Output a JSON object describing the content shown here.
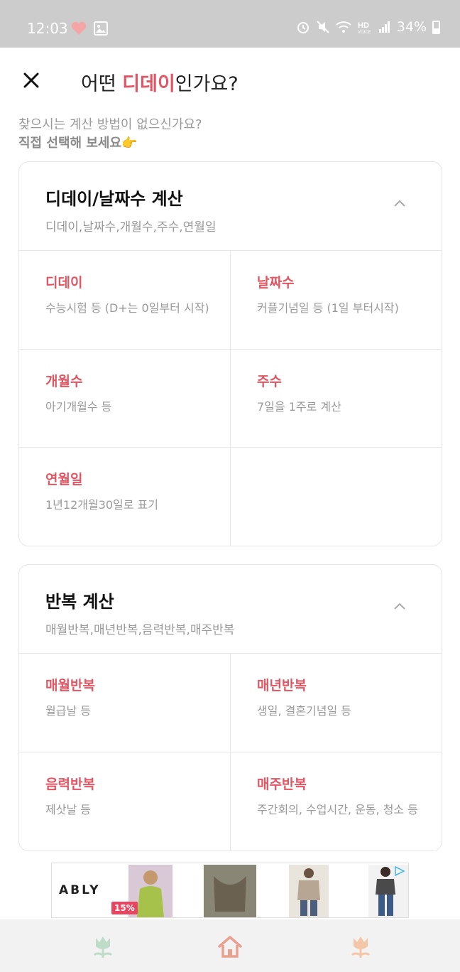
{
  "status_bar": {
    "time": "12:03",
    "battery": "34%",
    "left_icons": [
      "heart-icon",
      "image-icon"
    ],
    "right_icons": [
      "alarm-icon",
      "mute-icon",
      "wifi-icon",
      "hd-voice-icon",
      "signal-icon",
      "battery-icon"
    ]
  },
  "header": {
    "title_prefix": "어떤 ",
    "title_accent": "디데이",
    "title_suffix": "인가요?",
    "close_icon": "close-icon"
  },
  "hint": {
    "line1": "찾으시는 계산 방법이 없으신가요?",
    "line2": "직접 선택해 보세요👉"
  },
  "sections": [
    {
      "title": "디데이/날짜수 계산",
      "subtitle": "디데이,날짜수,개월수,주수,연월일",
      "items": [
        {
          "title": "디데이",
          "desc": "수능시험 등 (D+는 0일부터 시작)"
        },
        {
          "title": "날짜수",
          "desc": "커플기념일 등 (1일 부터시작)"
        },
        {
          "title": "개월수",
          "desc": "아기개월수 등"
        },
        {
          "title": "주수",
          "desc": "7일을 1주로 계산"
        },
        {
          "title": "연월일",
          "desc": "1년12개월30일로 표기"
        }
      ]
    },
    {
      "title": "반복 계산",
      "subtitle": "매월반복,매년반복,음력반복,매주반복",
      "items": [
        {
          "title": "매월반복",
          "desc": "월급날 등"
        },
        {
          "title": "매년반복",
          "desc": "생일, 결혼기념일 등"
        },
        {
          "title": "음력반복",
          "desc": "제삿날 등"
        },
        {
          "title": "매주반복",
          "desc": "주간회의, 수업시간, 운동, 청소 등"
        }
      ]
    }
  ],
  "ad": {
    "brand": "ABLY",
    "badge": "15%"
  },
  "bottom_nav": {
    "items": [
      "tulip-green-icon",
      "home-icon",
      "tulip-peach-icon"
    ]
  },
  "colors": {
    "accent": "#e25563",
    "status_bar": "#cccccc",
    "nav_bg": "#f2f2f2"
  }
}
